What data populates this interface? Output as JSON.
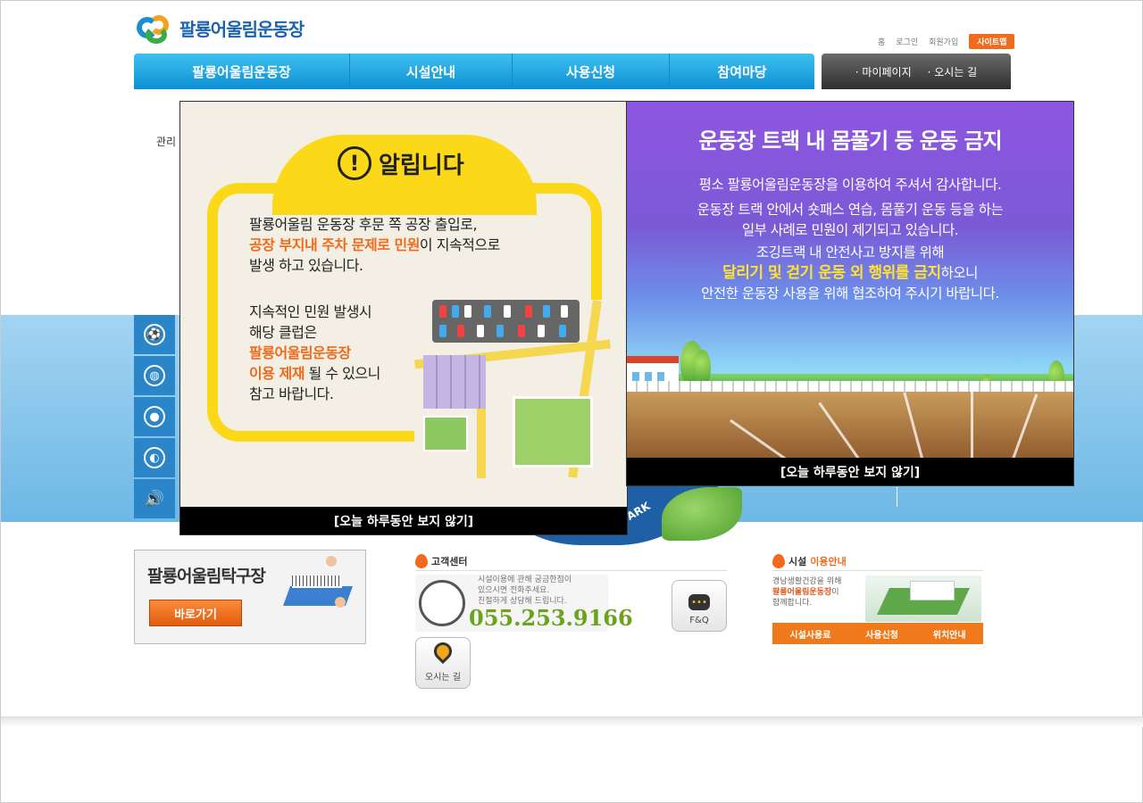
{
  "header": {
    "logo_text": "팔룡어울림운동장",
    "top_links": [
      "홈",
      "로그인",
      "회원가입"
    ],
    "sitemap_label": "사이트맵"
  },
  "gnb": {
    "items": [
      "팔룡어울림운동장",
      "시설안내",
      "사용신청",
      "참여마당"
    ],
    "sub": [
      "마이페이지",
      "오시는 길"
    ]
  },
  "breadcrumb": "관리",
  "quick_icons": [
    "soccer-ball-icon",
    "globe-icon",
    "basketball-icon",
    "volleyball-icon",
    "speaker-icon"
  ],
  "banner": {
    "ark_text": "ARK"
  },
  "pingpong": {
    "title": "팔룡어울림탁구장",
    "button": "바로가기"
  },
  "customer_center": {
    "title": "고객센터",
    "desc": [
      "시설이용에 관해 궁금한점이",
      "있으시면 전화주세요.",
      "친절하게 상담해 드립니다."
    ],
    "phone": "055.253.9166",
    "faq_label": "F&Q",
    "way_label": "오시는 길"
  },
  "facility": {
    "title_plain": "시설",
    "title_highlight": "이용안내",
    "desc_line1": "경남생활건강을 위해",
    "desc_highlight": "팔룡어울림운동장",
    "desc_suffix": "이",
    "desc_line3": "함께합니다.",
    "links": [
      "시설사용료",
      "사용신청",
      "위치안내"
    ]
  },
  "popup_notice": {
    "title": "알립니다",
    "p1_line1": "팔룡어울림 운동장 후문 쪽 공장 출입로,",
    "p1_line2_highlight": "공장 부지내 주차 문제로 민원",
    "p1_line2_rest": "이 지속적으로",
    "p1_line3": "발생 하고 있습니다.",
    "p2_line1": "지속적인 민원 발생시",
    "p2_line2": "해당 클럽은",
    "p2_line3_highlight": "팔룡어울림운동장",
    "p2_line4_highlight": "이용 제재",
    "p2_line4_rest": " 될 수 있으니",
    "p2_line5": "참고 바랍니다.",
    "close_label": "[오늘 하루동안 보지 않기]"
  },
  "popup_track": {
    "title": "운동장 트랙 내 몸풀기 등 운동 금지",
    "line1": "평소 팔룡어울림운동장을 이용하여 주셔서 감사합니다.",
    "line2": "운동장 트랙 안에서 숏패스 연습, 몸풀기 운동 등을 하는",
    "line3": "일부 사례로 민원이 제기되고 있습니다.",
    "line4": "조깅트랙 내 안전사고 방지를 위해",
    "line5_highlight": "달리기 및 걷기 운동 외 행위를 금지",
    "line5_rest": "하오니",
    "line6": "안전한 운동장 사용을 위해 협조하여 주시기 바랍니다.",
    "close_label": "[오늘 하루동안 보지 않기]"
  }
}
